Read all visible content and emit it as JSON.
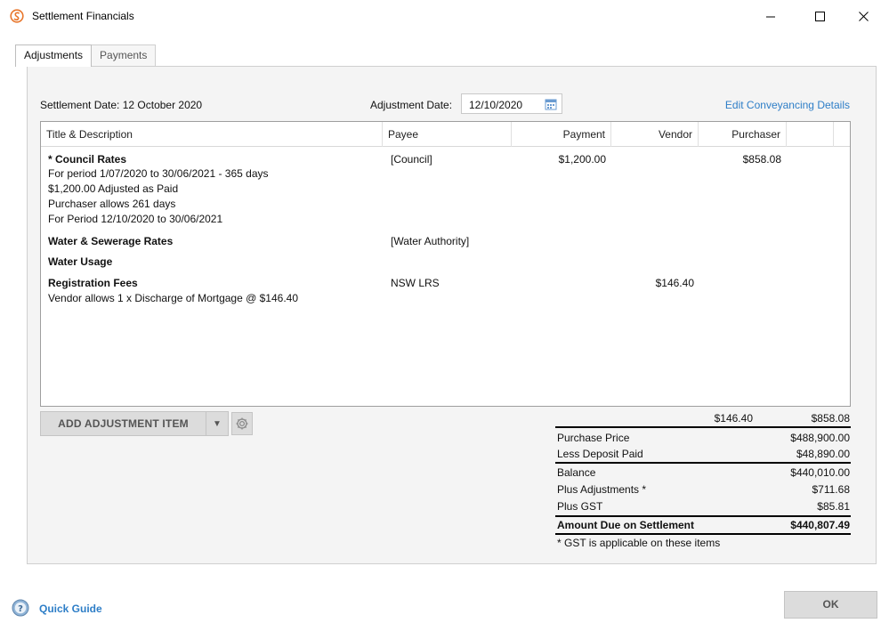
{
  "window": {
    "title": "Settlement Financials",
    "icon": "settle-logo-icon",
    "controls": [
      "minimize-icon",
      "maximize-icon",
      "close-icon"
    ]
  },
  "tabs": [
    {
      "label": "Adjustments",
      "active": true
    },
    {
      "label": "Payments",
      "active": false
    }
  ],
  "header": {
    "settlement_date": "Settlement Date: 12 October 2020",
    "adjustment_date_label": "Adjustment Date:",
    "adjustment_date_value": "12/10/2020",
    "edit_link": "Edit Conveyancing Details"
  },
  "grid": {
    "columns": [
      "Title & Description",
      "Payee",
      "Payment",
      "Vendor",
      "Purchaser"
    ],
    "rows": [
      {
        "title": "* Council Rates",
        "desc": [
          "For period 1/07/2020 to 30/06/2021 - 365 days",
          "$1,200.00 Adjusted as Paid",
          "Purchaser allows 261 days",
          "For Period 12/10/2020 to 30/06/2021"
        ],
        "payee": "[Council]",
        "payment": "$1,200.00",
        "vendor": "",
        "purchaser": "$858.08"
      },
      {
        "title": "Water & Sewerage Rates",
        "desc": [],
        "payee": "[Water Authority]",
        "payment": "",
        "vendor": "",
        "purchaser": ""
      },
      {
        "title": "Water Usage",
        "desc": [],
        "payee": "",
        "payment": "",
        "vendor": "",
        "purchaser": ""
      },
      {
        "title": "Registration Fees",
        "desc": [
          "Vendor allows 1 x Discharge of Mortgage @ $146.40"
        ],
        "payee": "NSW LRS",
        "payment": "",
        "vendor": "$146.40",
        "purchaser": ""
      }
    ]
  },
  "actions": {
    "add_item": "ADD ADJUSTMENT ITEM",
    "dropdown_glyph": "▼"
  },
  "totals": {
    "vendor_total": "$146.40",
    "purchaser_total": "$858.08",
    "lines": [
      {
        "label": "Purchase Price",
        "value": "$488,900.00"
      },
      {
        "label": "Less Deposit Paid",
        "value": "$48,890.00"
      },
      {
        "label": "Balance",
        "value": "$440,010.00"
      },
      {
        "label": "Plus Adjustments *",
        "value": "$711.68"
      },
      {
        "label": "Plus GST",
        "value": "$85.81"
      },
      {
        "label": "Amount Due on Settlement",
        "value": "$440,807.49"
      }
    ],
    "footnote": "* GST is applicable on these items"
  },
  "footer": {
    "quick_guide": "Quick Guide",
    "ok": "OK"
  },
  "colors": {
    "link": "#2e7ec7",
    "brand": "#e8762b",
    "button_bg": "#dcdcdc"
  }
}
